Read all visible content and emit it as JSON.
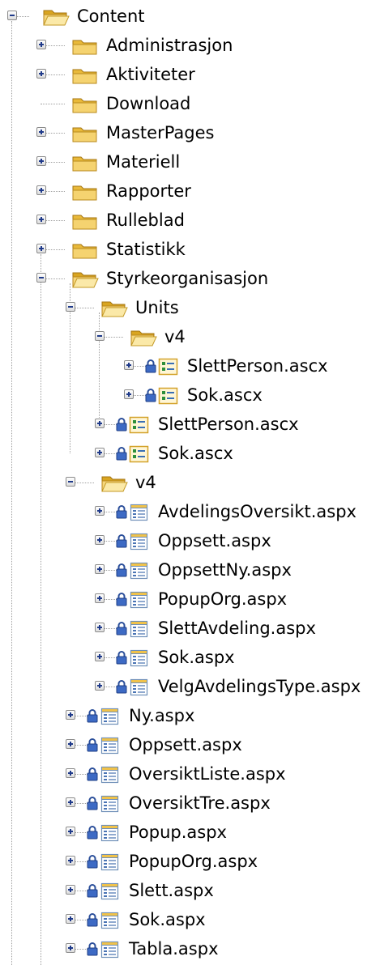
{
  "tree": {
    "root_label": "Content",
    "items": [
      {
        "label": "Administrasjon",
        "type": "folder",
        "level": 1,
        "expander": "plus"
      },
      {
        "label": "Aktiviteter",
        "type": "folder",
        "level": 1,
        "expander": "plus"
      },
      {
        "label": "Download",
        "type": "folder",
        "level": 1,
        "expander": "none"
      },
      {
        "label": "MasterPages",
        "type": "folder",
        "level": 1,
        "expander": "plus"
      },
      {
        "label": "Materiell",
        "type": "folder",
        "level": 1,
        "expander": "plus"
      },
      {
        "label": "Rapporter",
        "type": "folder",
        "level": 1,
        "expander": "plus"
      },
      {
        "label": "Rulleblad",
        "type": "folder",
        "level": 1,
        "expander": "plus"
      },
      {
        "label": "Statistikk",
        "type": "folder",
        "level": 1,
        "expander": "plus"
      },
      {
        "label": "Styrkeorganisasjon",
        "type": "folder-open",
        "level": 1,
        "expander": "minus"
      },
      {
        "label": "Units",
        "type": "folder-open",
        "level": 2,
        "expander": "minus"
      },
      {
        "label": "v4",
        "type": "folder-open",
        "level": 3,
        "expander": "minus"
      },
      {
        "label": "SlettPerson.ascx",
        "type": "ascx",
        "level": 4,
        "expander": "plus",
        "locked": true
      },
      {
        "label": "Sok.ascx",
        "type": "ascx",
        "level": 4,
        "expander": "plus",
        "locked": true
      },
      {
        "label": "SlettPerson.ascx",
        "type": "ascx",
        "level": 3,
        "expander": "plus",
        "locked": true
      },
      {
        "label": "Sok.ascx",
        "type": "ascx",
        "level": 3,
        "expander": "plus",
        "locked": true
      },
      {
        "label": "v4",
        "type": "folder-open",
        "level": 2,
        "expander": "minus"
      },
      {
        "label": "AvdelingsOversikt.aspx",
        "type": "aspx",
        "level": 3,
        "expander": "plus",
        "locked": true
      },
      {
        "label": "Oppsett.aspx",
        "type": "aspx",
        "level": 3,
        "expander": "plus",
        "locked": true
      },
      {
        "label": "OppsettNy.aspx",
        "type": "aspx",
        "level": 3,
        "expander": "plus",
        "locked": true
      },
      {
        "label": "PopupOrg.aspx",
        "type": "aspx",
        "level": 3,
        "expander": "plus",
        "locked": true
      },
      {
        "label": "SlettAvdeling.aspx",
        "type": "aspx",
        "level": 3,
        "expander": "plus",
        "locked": true
      },
      {
        "label": "Sok.aspx",
        "type": "aspx",
        "level": 3,
        "expander": "plus",
        "locked": true
      },
      {
        "label": "VelgAvdelingsType.aspx",
        "type": "aspx",
        "level": 3,
        "expander": "plus",
        "locked": true
      },
      {
        "label": "Ny.aspx",
        "type": "aspx",
        "level": 2,
        "expander": "plus",
        "locked": true
      },
      {
        "label": "Oppsett.aspx",
        "type": "aspx",
        "level": 2,
        "expander": "plus",
        "locked": true
      },
      {
        "label": "OversiktListe.aspx",
        "type": "aspx",
        "level": 2,
        "expander": "plus",
        "locked": true
      },
      {
        "label": "OversiktTre.aspx",
        "type": "aspx",
        "level": 2,
        "expander": "plus",
        "locked": true
      },
      {
        "label": "Popup.aspx",
        "type": "aspx",
        "level": 2,
        "expander": "plus",
        "locked": true
      },
      {
        "label": "PopupOrg.aspx",
        "type": "aspx",
        "level": 2,
        "expander": "plus",
        "locked": true
      },
      {
        "label": "Slett.aspx",
        "type": "aspx",
        "level": 2,
        "expander": "plus",
        "locked": true
      },
      {
        "label": "Sok.aspx",
        "type": "aspx",
        "level": 2,
        "expander": "plus",
        "locked": true
      },
      {
        "label": "Tabla.aspx",
        "type": "aspx",
        "level": 2,
        "expander": "plus",
        "locked": true
      }
    ]
  }
}
